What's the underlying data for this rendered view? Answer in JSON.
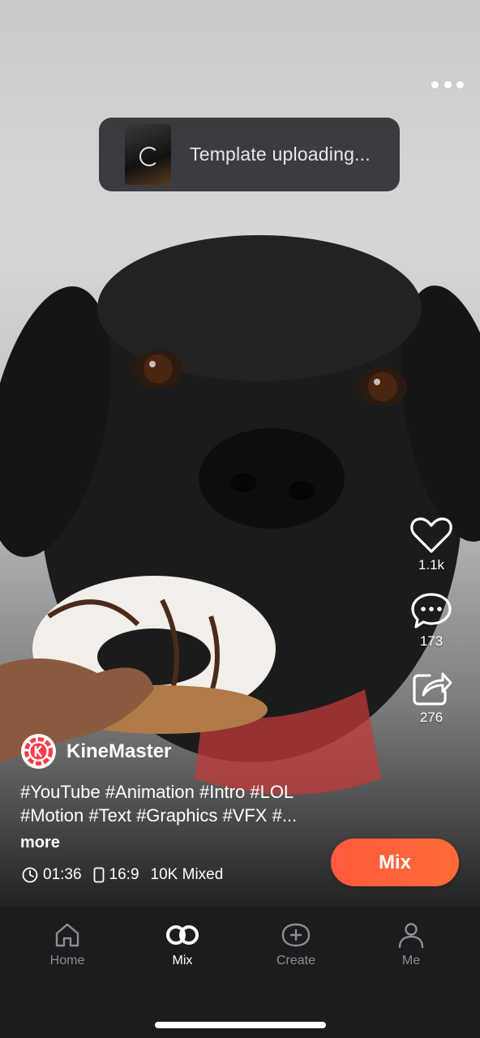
{
  "toast": {
    "text": "Template uploading..."
  },
  "actions": {
    "like_count": "1.1k",
    "comment_count": "173",
    "share_count": "276"
  },
  "creator": {
    "name": "KineMaster"
  },
  "post": {
    "tags_line1": "#YouTube  #Animation  #Intro #LOL",
    "tags_line2": "#Motion  #Text  #Graphics  #VFX #...",
    "more_label": "more",
    "duration": "01:36",
    "ratio": "16:9",
    "mixed_count": "10K Mixed"
  },
  "mix_button": {
    "label": "Mix"
  },
  "tabs": [
    {
      "label": "Home"
    },
    {
      "label": "Mix"
    },
    {
      "label": "Create"
    },
    {
      "label": "Me"
    }
  ],
  "colors": {
    "accent": "#ff5a3c",
    "tabbar_bg": "#1c1c1e",
    "toast_bg": "#34353a"
  }
}
